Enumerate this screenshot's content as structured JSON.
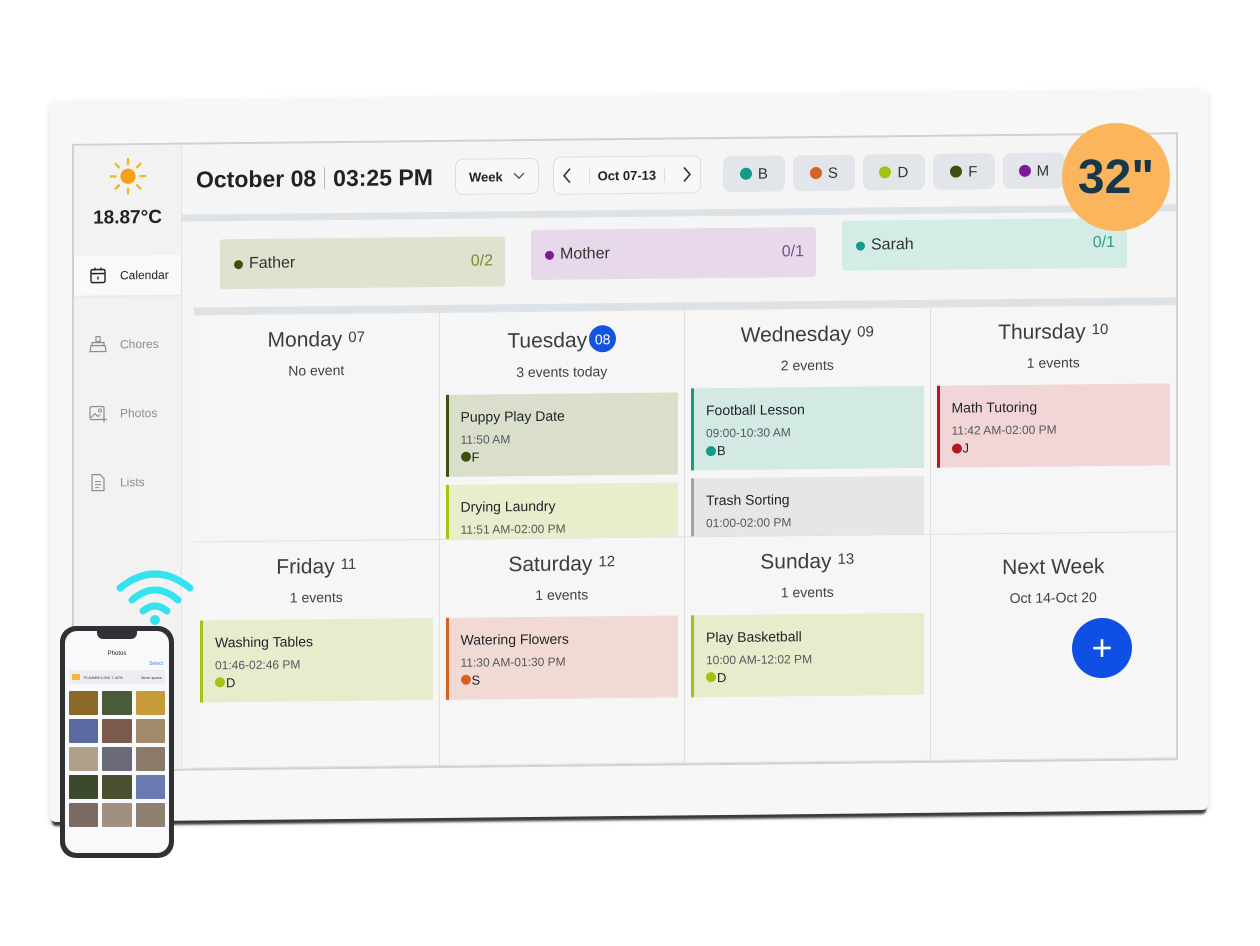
{
  "header": {
    "date": "October 08",
    "time": "03:25 PM",
    "view_select": "Week",
    "range_label": "Oct 07-13"
  },
  "weather": {
    "icon": "sun-icon",
    "temperature": "18.87°C"
  },
  "sidebar": {
    "items": [
      {
        "label": "Calendar",
        "icon": "calendar-icon",
        "active": true
      },
      {
        "label": "Chores",
        "icon": "broom-icon",
        "active": false
      },
      {
        "label": "Photos",
        "icon": "photo-add-icon",
        "active": false
      },
      {
        "label": "Lists",
        "icon": "document-icon",
        "active": false
      }
    ]
  },
  "members": [
    {
      "initial": "B",
      "color": "#14998a"
    },
    {
      "initial": "S",
      "color": "#d7611f"
    },
    {
      "initial": "D",
      "color": "#a6c211"
    },
    {
      "initial": "F",
      "color": "#3d5010"
    },
    {
      "initial": "M",
      "color": "#7e1b94"
    }
  ],
  "chore_progress": [
    {
      "name": "Father",
      "progress": "0/2",
      "color": "#3d5010",
      "bg": "#dfe2cf",
      "count_color": "#7a8a2a"
    },
    {
      "name": "Mother",
      "progress": "0/1",
      "color": "#7e1b94",
      "bg": "#e8d8ec",
      "count_color": "#7e4a90"
    },
    {
      "name": "Sarah",
      "progress": "0/1",
      "color": "#14998a",
      "bg": "#d4ece6",
      "count_color": "#2f9a86"
    }
  ],
  "days": [
    {
      "name": "Monday",
      "num": "07",
      "sub": "No event",
      "today": false,
      "events": []
    },
    {
      "name": "Tuesday",
      "num": "08",
      "sub": "3 events today",
      "today": true,
      "events": [
        {
          "title": "Puppy Play Date",
          "time": "11:50 AM",
          "who": "F",
          "color": "#3d5010",
          "bg": "#dadfcc"
        },
        {
          "title": "Drying Laundry",
          "time": "11:51 AM-02:00 PM",
          "who": "",
          "color": "#a6c211",
          "bg": "#e8eecb"
        }
      ]
    },
    {
      "name": "Wednesday",
      "num": "09",
      "sub": "2 events",
      "today": false,
      "events": [
        {
          "title": "Football Lesson",
          "time": "09:00-10:30 AM",
          "who": "B",
          "color": "#14998a",
          "bg": "#d2e9e4"
        },
        {
          "title": "Trash Sorting",
          "time": "01:00-02:00 PM",
          "who": "",
          "color": "#a4a4a4",
          "bg": "#e6e6e6"
        }
      ]
    },
    {
      "name": "Thursday",
      "num": "10",
      "sub": "1 events",
      "today": false,
      "events": [
        {
          "title": "Math Tutoring",
          "time": "11:42 AM-02:00 PM",
          "who": "J",
          "color": "#b3181c",
          "bg": "#f2d5d7"
        }
      ]
    },
    {
      "name": "Friday",
      "num": "11",
      "sub": "1 events",
      "today": false,
      "events": [
        {
          "title": "Washing Tables",
          "time": "01:46-02:46 PM",
          "who": "D",
          "color": "#a6c211",
          "bg": "#e7eccc"
        }
      ]
    },
    {
      "name": "Saturday",
      "num": "12",
      "sub": "1 events",
      "today": false,
      "events": [
        {
          "title": "Watering Flowers",
          "time": "11:30 AM-01:30 PM",
          "who": "S",
          "color": "#d7611f",
          "bg": "#f1dad3"
        }
      ]
    },
    {
      "name": "Sunday",
      "num": "13",
      "sub": "1 events",
      "today": false,
      "events": [
        {
          "title": "Play Basketball",
          "time": "10:00 AM-12:02 PM",
          "who": "D",
          "color": "#a6c211",
          "bg": "#e7eccc"
        }
      ]
    }
  ],
  "next_week": {
    "title": "Next Week",
    "range": "Oct 14-Oct 20"
  },
  "fab": {
    "label": "+"
  },
  "badge": {
    "text": "32\""
  },
  "phone": {
    "title": "Photos",
    "select_label": "Select",
    "storage_text": "75.84MB/1,000  7.42%",
    "more_space": "More space"
  },
  "colors": {
    "accent": "#0f4fe4",
    "badge": "#fbb55d",
    "wifi": "#33e3f0"
  }
}
